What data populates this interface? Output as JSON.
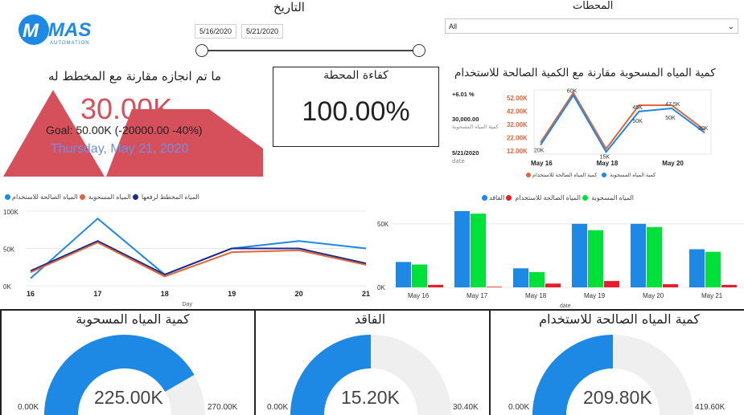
{
  "logo": {
    "text": "MAS",
    "sub": "AUTOMATION"
  },
  "date_filter": {
    "title": "التاريخ",
    "start": "5/16/2020",
    "end": "5/21/2020"
  },
  "station_filter": {
    "title": "المحطات",
    "value": "All"
  },
  "kpi_goal": {
    "title": "ما تم انجازه مقارنة مع المخطط له",
    "value": "30.00K",
    "goal": "Goal: 50.00K (-20000.00 -40%)",
    "date": "Thursday, May 21, 2020",
    "color": "#d6505c"
  },
  "efficiency": {
    "title": "كفاءة المحطة",
    "value": "100.00%"
  },
  "comparison": {
    "title": "كمية المياه المسحوبة مقارنة مع الكمية الصالحة للاستخدام",
    "change": "+6.01 %",
    "amount": "30,000.00",
    "amount_label": "كمية المياه المسحوبة",
    "date": "5/21/2020",
    "date_label": "date",
    "legend": [
      "كمية المياه المسحوبة",
      "كمية المياه الصالحة للاستخدام"
    ]
  },
  "colors": {
    "blue": "#1e88e5",
    "orange": "#e0663a",
    "navy": "#1c2a8c",
    "green": "#00e03a",
    "red": "#e81e2c",
    "track": "#efefef"
  },
  "chart_data": [
    {
      "type": "line",
      "title": "كمية المياه المسحوبة مقارنة مع الكمية الصالحة للاستخدام",
      "x": [
        "May 16",
        "May 17",
        "May 18",
        "May 19",
        "May 20",
        "May 21"
      ],
      "x_ticks": [
        "May 16",
        "May 18",
        "May 20"
      ],
      "y_ticks": [
        "52.00K",
        "42.00K",
        "32.00K",
        "22.00K",
        "12.00K"
      ],
      "ylim": [
        12000,
        52000
      ],
      "series": [
        {
          "name": "كمية المياه المسحوبة",
          "values": [
            20000,
            60000,
            15000,
            50000,
            50000,
            30000
          ],
          "labels": [
            "20K",
            "",
            "15K",
            "",
            "",
            ""
          ]
        },
        {
          "name": "كمية المياه الصالحة للاستخدام",
          "values": [
            18000,
            58000,
            12500,
            45000,
            47500,
            28000
          ],
          "labels": [
            "",
            "60K",
            "",
            "45K",
            "47.5K",
            "30K"
          ],
          "alt_labels": [
            "",
            "",
            "",
            "50K",
            "50K",
            ""
          ]
        }
      ]
    },
    {
      "type": "line",
      "x": [
        "16",
        "17",
        "18",
        "19",
        "20",
        "21"
      ],
      "xlabel": "Day",
      "y_ticks": [
        "100K",
        "50K",
        "0K"
      ],
      "ylim": [
        0,
        100000
      ],
      "legend": [
        "المياه المخطط لرفعها",
        "المياه المسحوبة",
        "المياه الصالحة للاستخدام"
      ],
      "series": [
        {
          "name": "المياه المخطط لرفعها",
          "values": [
            10000,
            90000,
            15000,
            50000,
            60000,
            50000
          ]
        },
        {
          "name": "المياه المسحوبة",
          "values": [
            20000,
            60000,
            15000,
            50000,
            50000,
            30000
          ]
        },
        {
          "name": "المياه الصالحة للاستخدام",
          "values": [
            18000,
            58000,
            12500,
            45000,
            47500,
            28000
          ]
        }
      ]
    },
    {
      "type": "bar",
      "categories": [
        "May 16",
        "May 17",
        "May 18",
        "May 19",
        "May 20",
        "May 21"
      ],
      "xlabel": "date",
      "y_ticks": [
        "50K",
        "0K"
      ],
      "ylim": [
        0,
        60000
      ],
      "legend": [
        "المياه المسحوبة",
        "المياه الصالحة للاستخدام",
        "الفاقد"
      ],
      "series": [
        {
          "name": "المياه المسحوبة",
          "values": [
            20000,
            60000,
            15000,
            50000,
            50000,
            30000
          ]
        },
        {
          "name": "المياه الصالحة للاستخدام",
          "values": [
            18000,
            58000,
            12000,
            45000,
            47500,
            28000
          ]
        },
        {
          "name": "الفاقد",
          "values": [
            2000,
            500,
            3000,
            5000,
            2500,
            2000
          ]
        }
      ]
    }
  ],
  "gauges": [
    {
      "title": "كمية المياه المسحوبة",
      "value": "225.00K",
      "min": "0.00K",
      "max": "270.00K",
      "fraction": 0.833
    },
    {
      "title": "الفاقد",
      "value": "15.20K",
      "min": "0.00K",
      "max": "30.40K",
      "fraction": 0.5
    },
    {
      "title": "كمية المياه الصالحة للاستخدام",
      "value": "209.80K",
      "min": "0.00K",
      "max": "419.60K",
      "fraction": 0.5
    }
  ]
}
